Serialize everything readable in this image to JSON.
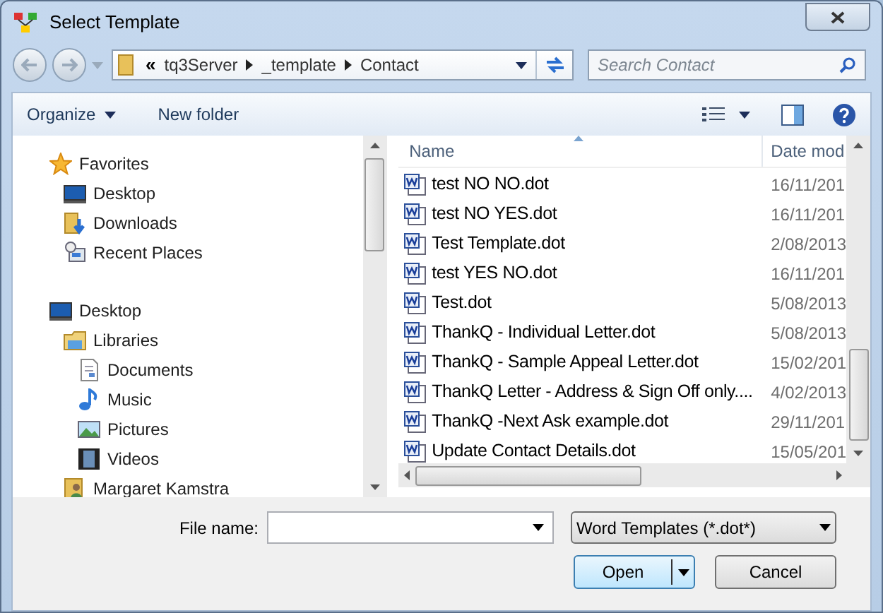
{
  "window": {
    "title": "Select Template"
  },
  "address": {
    "crumbs": [
      "«",
      "tq3Server",
      "_template",
      "Contact"
    ]
  },
  "search": {
    "placeholder": "Search Contact"
  },
  "toolbar": [
    "Organize",
    "New folder"
  ],
  "navigation": [
    {
      "label": "Favorites",
      "kind": "star",
      "children": [
        {
          "label": "Desktop",
          "kind": "desktop"
        },
        {
          "label": "Downloads",
          "kind": "downloads"
        },
        {
          "label": "Recent Places",
          "kind": "recent"
        }
      ]
    },
    {
      "label": "Desktop",
      "kind": "desktop",
      "children": [
        {
          "label": "Libraries",
          "kind": "libraries",
          "children": [
            {
              "label": "Documents",
              "kind": "documents"
            },
            {
              "label": "Music",
              "kind": "music"
            },
            {
              "label": "Pictures",
              "kind": "pictures"
            },
            {
              "label": "Videos",
              "kind": "videos"
            }
          ]
        },
        {
          "label": "Margaret Kamstra",
          "kind": "user"
        }
      ]
    }
  ],
  "files": {
    "columns": [
      "Name",
      "Date mod"
    ],
    "rows": [
      {
        "name": "test NO NO.dot",
        "date": "16/11/201"
      },
      {
        "name": "test NO YES.dot",
        "date": "16/11/201"
      },
      {
        "name": "Test Template.dot",
        "date": "2/08/2013"
      },
      {
        "name": "test YES NO.dot",
        "date": "16/11/201"
      },
      {
        "name": "Test.dot",
        "date": "5/08/2013"
      },
      {
        "name": "ThankQ - Individual Letter.dot",
        "date": "5/08/2013"
      },
      {
        "name": "ThankQ - Sample Appeal Letter.dot",
        "date": "15/02/201"
      },
      {
        "name": "ThankQ Letter - Address & Sign Off only....",
        "date": "4/02/2013"
      },
      {
        "name": "ThankQ -Next Ask example.dot",
        "date": "29/11/201"
      },
      {
        "name": "Update Contact Details.dot",
        "date": "15/05/201"
      }
    ]
  },
  "file_name": {
    "label": "File name:"
  },
  "file_type": {
    "value": "Word Templates (*.dot*)"
  },
  "buttons": [
    "Open",
    "Cancel"
  ]
}
